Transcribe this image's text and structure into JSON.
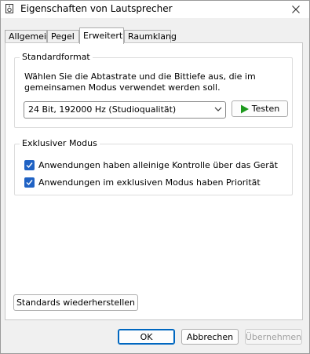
{
  "window": {
    "title": "Eigenschaften von Lautsprecher"
  },
  "tabs": [
    {
      "label": "Allgemein"
    },
    {
      "label": "Pegel"
    },
    {
      "label": "Erweitert"
    },
    {
      "label": "Raumklang"
    }
  ],
  "standardformat": {
    "legend": "Standardformat",
    "description": "Wählen Sie die Abtastrate und die Bittiefe aus, die im gemeinsamen Modus verwendet werden soll.",
    "selected_format": "24 Bit, 192000 Hz (Studioqualität)",
    "test_label": "Testen"
  },
  "exclusive": {
    "legend": "Exklusiver Modus",
    "options": [
      {
        "label": "Anwendungen haben alleinige Kontrolle über das Gerät",
        "checked": true
      },
      {
        "label": "Anwendungen im exklusiven Modus haben Priorität",
        "checked": true
      }
    ]
  },
  "restore_label": "Standards wiederherstellen",
  "footer": {
    "ok": "OK",
    "cancel": "Abbrechen",
    "apply": "Übernehmen"
  },
  "colors": {
    "accent": "#1f62c4",
    "play": "#1e9a1e",
    "disabled_text": "#a0a0a0"
  }
}
